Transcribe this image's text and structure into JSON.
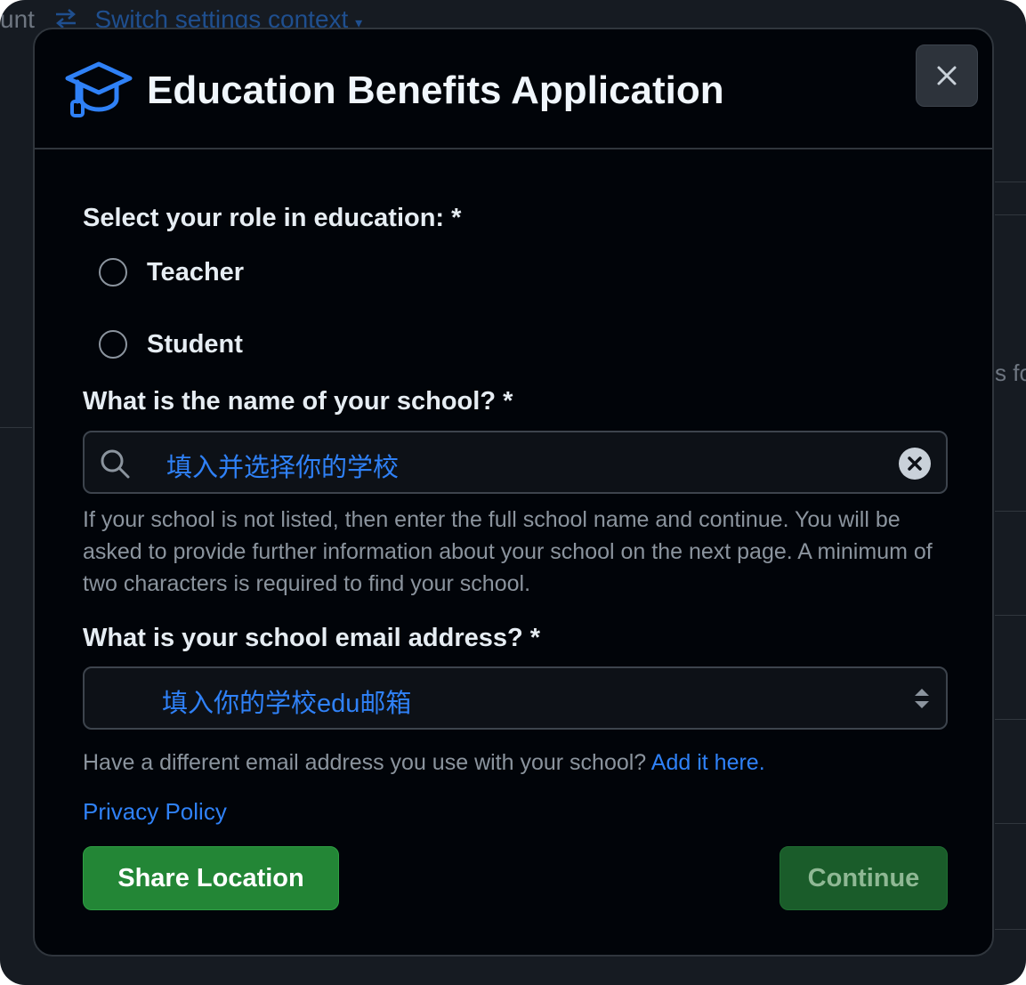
{
  "background": {
    "left_text": "unt",
    "switch_context_label": "Switch settings context",
    "right_fragment": "s fo"
  },
  "modal": {
    "title": "Education Benefits Application",
    "icon": "graduation-cap-icon",
    "close_icon": "close-icon"
  },
  "role": {
    "label": "Select your role in education: *",
    "options": [
      "Teacher",
      "Student"
    ]
  },
  "school": {
    "label": "What is the name of your school? *",
    "input_value": "填入并选择你的学校",
    "help": "If your school is not listed, then enter the full school name and continue. You will be asked to provide further information about your school on the next page. A minimum of two characters is required to find your school."
  },
  "email": {
    "label": "What is your school email address? *",
    "select_value": "填入你的学校edu邮箱",
    "help_prefix": "Have a different email address you use with your school?",
    "help_link": "Add it here."
  },
  "privacy_link": "Privacy Policy",
  "buttons": {
    "share_location": "Share Location",
    "continue": "Continue"
  },
  "colors": {
    "accent_link": "#2f81f7",
    "primary_button": "#238636",
    "modal_background": "#010409"
  }
}
